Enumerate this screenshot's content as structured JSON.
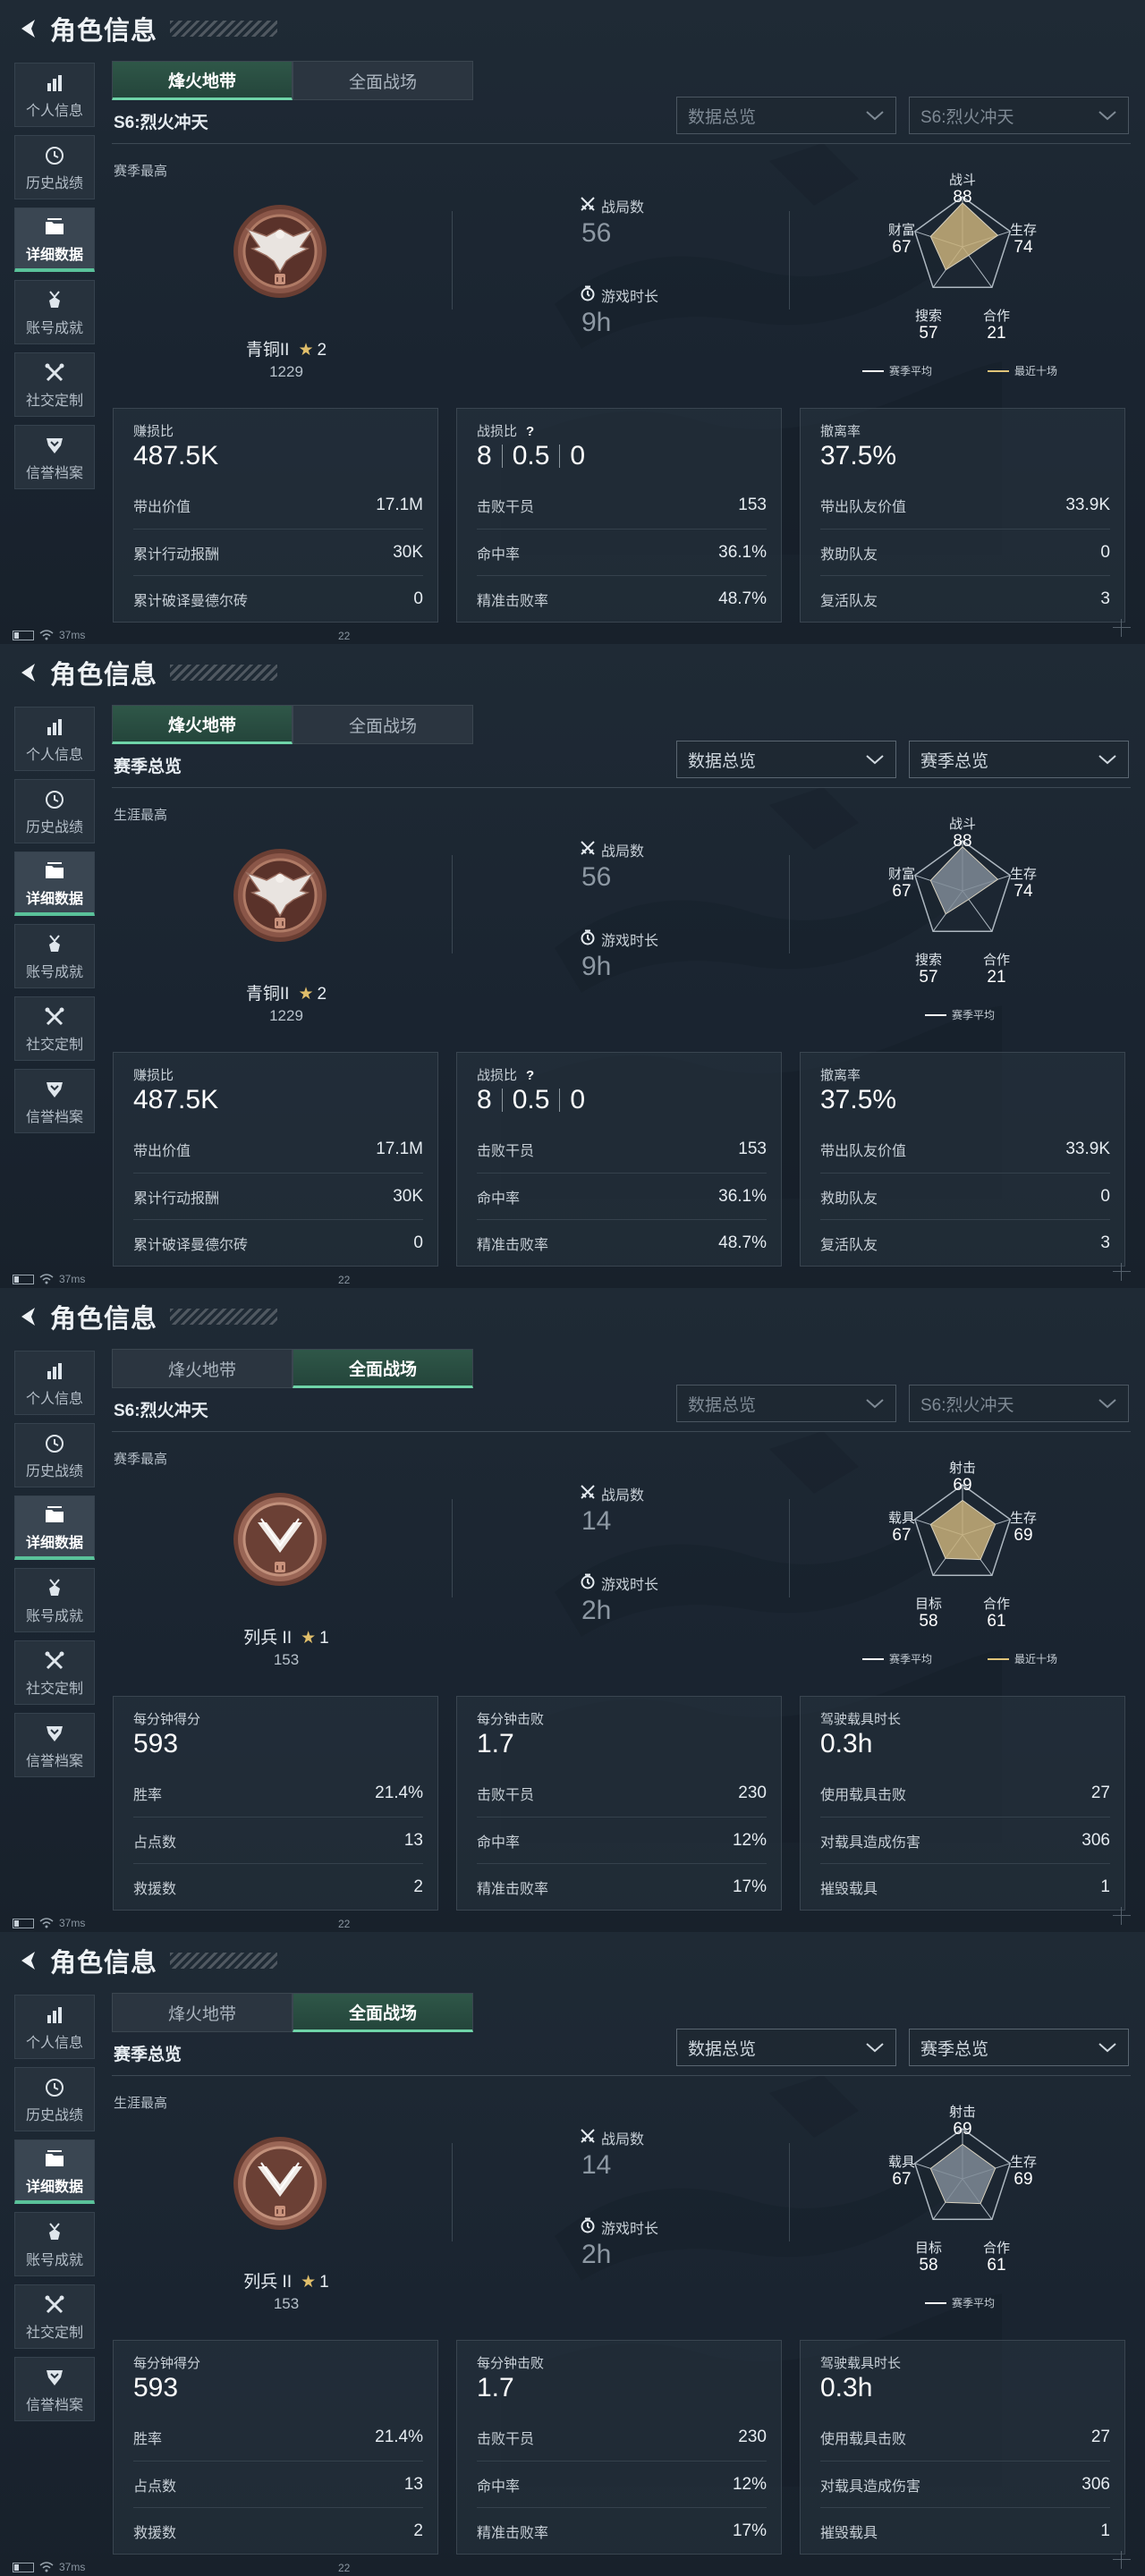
{
  "header": {
    "title": "角色信息"
  },
  "sidebar": [
    {
      "label": "个人信息",
      "icon": "bar-chart-icon",
      "active": false
    },
    {
      "label": "历史战绩",
      "icon": "clock-icon",
      "active": false
    },
    {
      "label": "详细数据",
      "icon": "folder-icon",
      "active": true
    },
    {
      "label": "账号成就",
      "icon": "medal-icon",
      "active": false
    },
    {
      "label": "社交定制",
      "icon": "crossed-tools-icon",
      "active": false
    },
    {
      "label": "信誉档案",
      "icon": "shield-icon",
      "active": false
    }
  ],
  "status_bar": {
    "ping": "37ms",
    "frame": "22"
  },
  "colors": {
    "accent_green": "#6fd4a8",
    "season_avg_line": "#ffffff",
    "recent_ten_line": "#e0c479",
    "radar_fill_gold": "#c8b07a",
    "radar_fill_grey": "#7f8b96"
  },
  "panels": [
    {
      "tabs": [
        "烽火地带",
        "全面战场"
      ],
      "active_tab": 0,
      "season_label": "S6:烈火冲天",
      "dropdown1": "数据总览",
      "dropdown2": "S6:烈火冲天",
      "dropdowns_enabled": false,
      "best_label": "赛季最高",
      "rank": {
        "name": "青铜II",
        "stars": "2",
        "points": "1229",
        "badge": "eagle"
      },
      "stats": [
        {
          "label": "战局数",
          "value": "56",
          "icon": "crossed-swords-icon"
        },
        {
          "label": "游戏时长",
          "value": "9h",
          "icon": "timer-icon"
        }
      ],
      "radar": {
        "axes": [
          {
            "label": "战斗",
            "value": "88",
            "fraction": 0.88
          },
          {
            "label": "生存",
            "value": "74",
            "fraction": 0.74
          },
          {
            "label": "合作",
            "value": "21",
            "fraction": 0.21
          },
          {
            "label": "搜索",
            "value": "57",
            "fraction": 0.57
          },
          {
            "label": "财富",
            "value": "67",
            "fraction": 0.67
          }
        ],
        "fill": "gold",
        "legend": [
          {
            "label": "赛季平均",
            "color": "#ffffff"
          },
          {
            "label": "最近十场",
            "color": "#e0c479"
          }
        ]
      },
      "cards": [
        {
          "title": "赚损比",
          "big": [
            "487.5K"
          ],
          "info": false,
          "rows": [
            {
              "k": "带出价值",
              "v": "17.1M"
            },
            {
              "k": "累计行动报酬",
              "v": "30K"
            },
            {
              "k": "累计破译曼德尔砖",
              "v": "0"
            }
          ]
        },
        {
          "title": "战损比",
          "big": [
            "8",
            "0.5",
            "0"
          ],
          "info": true,
          "rows": [
            {
              "k": "击败干员",
              "v": "153"
            },
            {
              "k": "命中率",
              "v": "36.1%"
            },
            {
              "k": "精准击败率",
              "v": "48.7%"
            }
          ]
        },
        {
          "title": "撤离率",
          "big": [
            "37.5%"
          ],
          "info": false,
          "rows": [
            {
              "k": "带出队友价值",
              "v": "33.9K"
            },
            {
              "k": "救助队友",
              "v": "0"
            },
            {
              "k": "复活队友",
              "v": "3"
            }
          ]
        }
      ]
    },
    {
      "tabs": [
        "烽火地带",
        "全面战场"
      ],
      "active_tab": 0,
      "season_label": "赛季总览",
      "dropdown1": "数据总览",
      "dropdown2": "赛季总览",
      "dropdowns_enabled": true,
      "best_label": "生涯最高",
      "rank": {
        "name": "青铜II",
        "stars": "2",
        "points": "1229",
        "badge": "eagle"
      },
      "stats": [
        {
          "label": "战局数",
          "value": "56",
          "icon": "crossed-swords-icon"
        },
        {
          "label": "游戏时长",
          "value": "9h",
          "icon": "timer-icon"
        }
      ],
      "radar": {
        "axes": [
          {
            "label": "战斗",
            "value": "88",
            "fraction": 0.88
          },
          {
            "label": "生存",
            "value": "74",
            "fraction": 0.74
          },
          {
            "label": "合作",
            "value": "21",
            "fraction": 0.21
          },
          {
            "label": "搜索",
            "value": "57",
            "fraction": 0.57
          },
          {
            "label": "财富",
            "value": "67",
            "fraction": 0.67
          }
        ],
        "fill": "grey",
        "legend": [
          {
            "label": "赛季平均",
            "color": "#ffffff"
          }
        ]
      },
      "cards": [
        {
          "title": "赚损比",
          "big": [
            "487.5K"
          ],
          "info": false,
          "rows": [
            {
              "k": "带出价值",
              "v": "17.1M"
            },
            {
              "k": "累计行动报酬",
              "v": "30K"
            },
            {
              "k": "累计破译曼德尔砖",
              "v": "0"
            }
          ]
        },
        {
          "title": "战损比",
          "big": [
            "8",
            "0.5",
            "0"
          ],
          "info": true,
          "rows": [
            {
              "k": "击败干员",
              "v": "153"
            },
            {
              "k": "命中率",
              "v": "36.1%"
            },
            {
              "k": "精准击败率",
              "v": "48.7%"
            }
          ]
        },
        {
          "title": "撤离率",
          "big": [
            "37.5%"
          ],
          "info": false,
          "rows": [
            {
              "k": "带出队友价值",
              "v": "33.9K"
            },
            {
              "k": "救助队友",
              "v": "0"
            },
            {
              "k": "复活队友",
              "v": "3"
            }
          ]
        }
      ]
    },
    {
      "tabs": [
        "烽火地带",
        "全面战场"
      ],
      "active_tab": 1,
      "season_label": "S6:烈火冲天",
      "dropdown1": "数据总览",
      "dropdown2": "S6:烈火冲天",
      "dropdowns_enabled": false,
      "best_label": "赛季最高",
      "rank": {
        "name": "列兵 II",
        "stars": "1",
        "points": "153",
        "badge": "chevron"
      },
      "stats": [
        {
          "label": "战局数",
          "value": "14",
          "icon": "crossed-swords-icon"
        },
        {
          "label": "游戏时长",
          "value": "2h",
          "icon": "timer-icon"
        }
      ],
      "radar": {
        "axes": [
          {
            "label": "射击",
            "value": "69",
            "fraction": 0.69
          },
          {
            "label": "生存",
            "value": "69",
            "fraction": 0.69
          },
          {
            "label": "合作",
            "value": "61",
            "fraction": 0.61
          },
          {
            "label": "目标",
            "value": "58",
            "fraction": 0.58
          },
          {
            "label": "载具",
            "value": "67",
            "fraction": 0.67
          }
        ],
        "fill": "gold",
        "legend": [
          {
            "label": "赛季平均",
            "color": "#ffffff"
          },
          {
            "label": "最近十场",
            "color": "#e0c479"
          }
        ]
      },
      "cards": [
        {
          "title": "每分钟得分",
          "big": [
            "593"
          ],
          "info": false,
          "rows": [
            {
              "k": "胜率",
              "v": "21.4%"
            },
            {
              "k": "占点数",
              "v": "13"
            },
            {
              "k": "救援数",
              "v": "2"
            }
          ]
        },
        {
          "title": "每分钟击败",
          "big": [
            "1.7"
          ],
          "info": false,
          "rows": [
            {
              "k": "击败干员",
              "v": "230"
            },
            {
              "k": "命中率",
              "v": "12%"
            },
            {
              "k": "精准击败率",
              "v": "17%"
            }
          ]
        },
        {
          "title": "驾驶载具时长",
          "big": [
            "0.3h"
          ],
          "info": false,
          "rows": [
            {
              "k": "使用载具击败",
              "v": "27"
            },
            {
              "k": "对载具造成伤害",
              "v": "306"
            },
            {
              "k": "摧毁载具",
              "v": "1"
            }
          ]
        }
      ]
    },
    {
      "tabs": [
        "烽火地带",
        "全面战场"
      ],
      "active_tab": 1,
      "season_label": "赛季总览",
      "dropdown1": "数据总览",
      "dropdown2": "赛季总览",
      "dropdowns_enabled": true,
      "best_label": "生涯最高",
      "rank": {
        "name": "列兵 II",
        "stars": "1",
        "points": "153",
        "badge": "chevron"
      },
      "stats": [
        {
          "label": "战局数",
          "value": "14",
          "icon": "crossed-swords-icon"
        },
        {
          "label": "游戏时长",
          "value": "2h",
          "icon": "timer-icon"
        }
      ],
      "radar": {
        "axes": [
          {
            "label": "射击",
            "value": "69",
            "fraction": 0.69
          },
          {
            "label": "生存",
            "value": "69",
            "fraction": 0.69
          },
          {
            "label": "合作",
            "value": "61",
            "fraction": 0.61
          },
          {
            "label": "目标",
            "value": "58",
            "fraction": 0.58
          },
          {
            "label": "载具",
            "value": "67",
            "fraction": 0.67
          }
        ],
        "fill": "grey",
        "legend": [
          {
            "label": "赛季平均",
            "color": "#ffffff"
          }
        ]
      },
      "cards": [
        {
          "title": "每分钟得分",
          "big": [
            "593"
          ],
          "info": false,
          "rows": [
            {
              "k": "胜率",
              "v": "21.4%"
            },
            {
              "k": "占点数",
              "v": "13"
            },
            {
              "k": "救援数",
              "v": "2"
            }
          ]
        },
        {
          "title": "每分钟击败",
          "big": [
            "1.7"
          ],
          "info": false,
          "rows": [
            {
              "k": "击败干员",
              "v": "230"
            },
            {
              "k": "命中率",
              "v": "12%"
            },
            {
              "k": "精准击败率",
              "v": "17%"
            }
          ]
        },
        {
          "title": "驾驶载具时长",
          "big": [
            "0.3h"
          ],
          "info": false,
          "rows": [
            {
              "k": "使用载具击败",
              "v": "27"
            },
            {
              "k": "对载具造成伤害",
              "v": "306"
            },
            {
              "k": "摧毁载具",
              "v": "1"
            }
          ]
        }
      ]
    }
  ]
}
